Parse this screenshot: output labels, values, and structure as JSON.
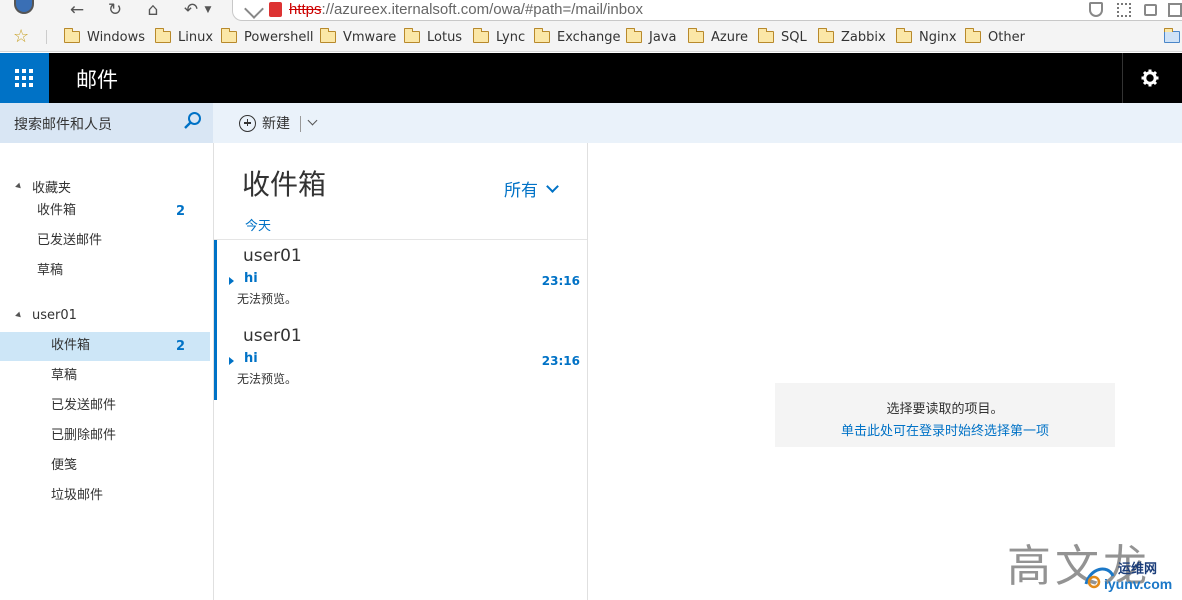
{
  "browser": {
    "url_protocol": "https",
    "url_rest": "://azureex.iternalsoft.com/owa/#path=/mail/inbox",
    "bookmarks": [
      "Windows",
      "Linux",
      "Powershell",
      "Vmware",
      "Lotus",
      "Lync",
      "Exchange",
      "Java",
      "Azure",
      "SQL",
      "Zabbix",
      "Nginx",
      "Other"
    ]
  },
  "header": {
    "app_title": "邮件"
  },
  "search": {
    "placeholder": "搜索邮件和人员"
  },
  "toolbar": {
    "new_label": "新建"
  },
  "folders": {
    "favorites": {
      "label": "收藏夹",
      "items": [
        {
          "label": "收件箱",
          "count": "2"
        },
        {
          "label": "已发送邮件"
        },
        {
          "label": "草稿"
        }
      ]
    },
    "account": {
      "label": "user01",
      "items": [
        {
          "label": "收件箱",
          "count": "2"
        },
        {
          "label": "草稿"
        },
        {
          "label": "已发送邮件"
        },
        {
          "label": "已删除邮件"
        },
        {
          "label": "便笺"
        },
        {
          "label": "垃圾邮件"
        }
      ]
    }
  },
  "message_list": {
    "title": "收件箱",
    "filter": "所有",
    "group_label": "今天",
    "messages": [
      {
        "sender": "user01",
        "subject": "hi",
        "time": "23:16",
        "preview": "无法预览。"
      },
      {
        "sender": "user01",
        "subject": "hi",
        "time": "23:16",
        "preview": "无法预览。"
      }
    ]
  },
  "reading_pane": {
    "hint": "选择要读取的项目。",
    "link": "单击此处可在登录时始终选择第一项"
  },
  "watermark": {
    "text": "高文龙",
    "site_cn": "运维网",
    "site": "iyunv.com"
  },
  "colors": {
    "accent": "#0072c6",
    "header_bg": "#000000",
    "selected_bg": "#cde6f7",
    "command_bar_bg": "#eaf2fa"
  }
}
